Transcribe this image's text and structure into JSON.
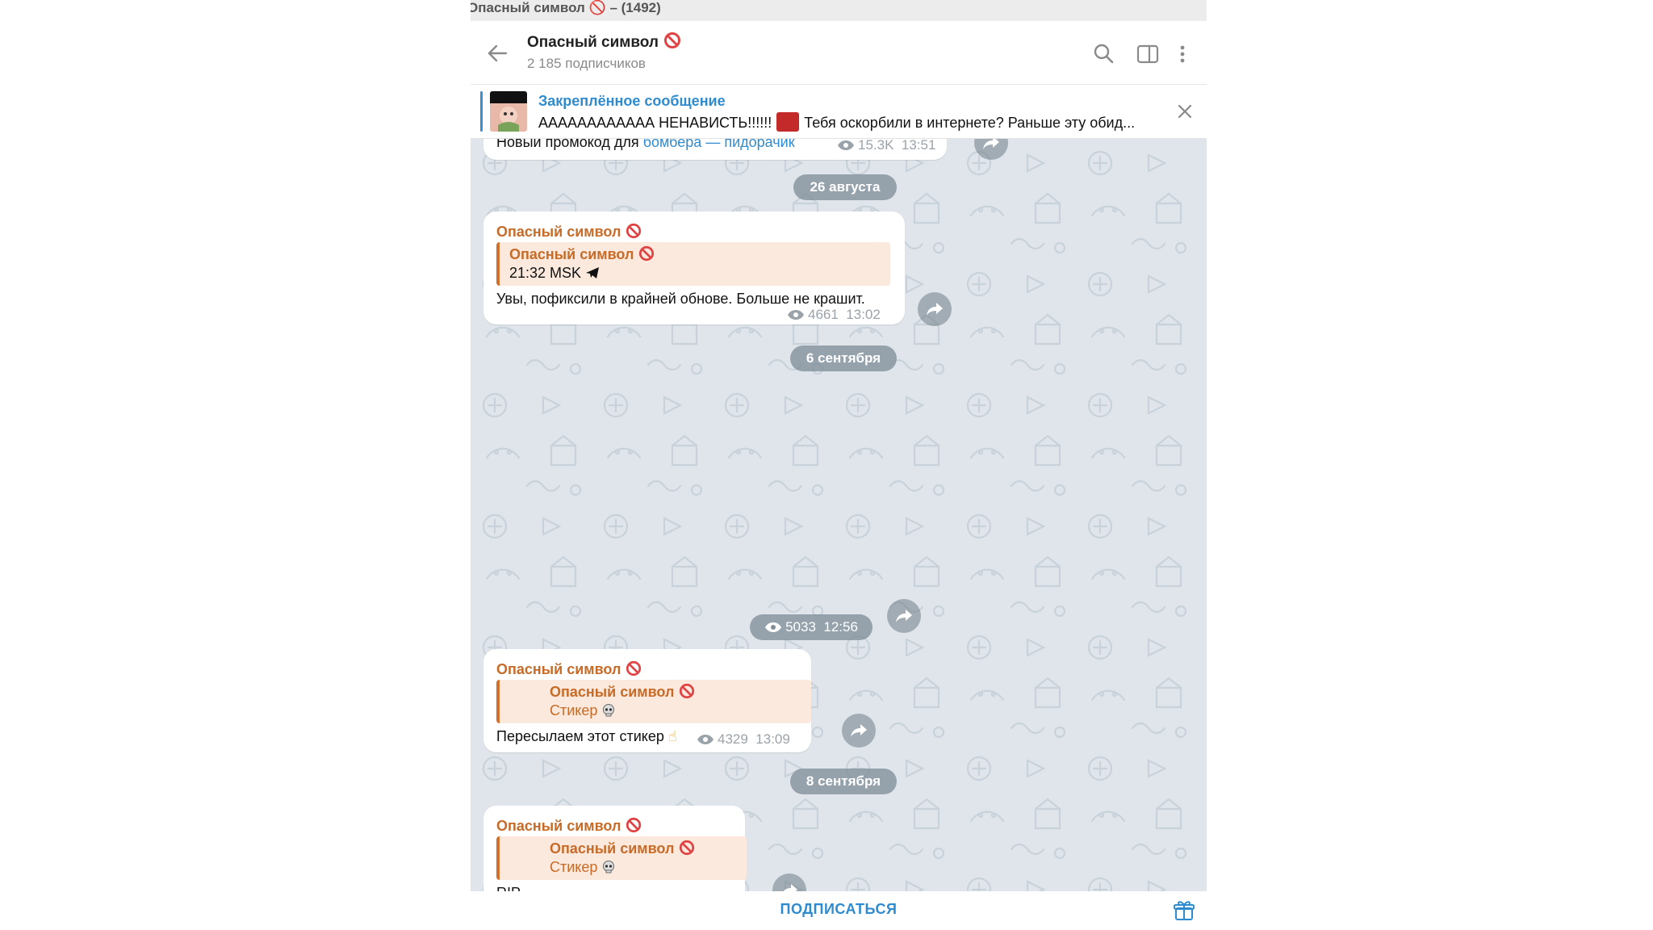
{
  "window": {
    "title": "Опасный символ 🚫 – (1492)"
  },
  "header": {
    "channel_name": "Опасный символ",
    "subscribers": "2 185 подписчиков",
    "icons": [
      "back-arrow-icon",
      "search-icon",
      "sidebar-toggle-icon",
      "more-vertical-icon"
    ]
  },
  "pinned": {
    "title": "Закреплённое сообщение",
    "text_before": "АААААААААААА НЕНАВИСТЬ!!!!!!",
    "text_after": "Тебя оскорбили в интернете? Раньше эту обид..."
  },
  "messages": [
    {
      "partial_text_prefix": "Новый промокод для",
      "partial_link": "бомбера",
      "partial_text_suffix": "— пидорачик",
      "views": "15.3K",
      "time": "13:51"
    },
    {
      "sender": "Опасный символ",
      "reply_name": "Опасный символ",
      "reply_text": "21:32 MSK",
      "text": "Увы, пофиксили в крайней обнове. Больше не крашит.",
      "views": "4661",
      "time": "13:02"
    },
    {
      "views": "5033",
      "time": "12:56"
    },
    {
      "sender": "Опасный символ",
      "reply_name": "Опасный символ",
      "reply_text": "Стикер",
      "text": "Пересылаем этот стикер",
      "emoji": "☝",
      "views": "4329",
      "time": "13:09"
    },
    {
      "sender": "Опасный символ",
      "reply_name": "Опасный символ",
      "reply_text": "Стикер",
      "text": "RIP"
    }
  ],
  "dates": [
    "26 августа",
    "6 сентября",
    "8 сентября"
  ],
  "bottom": {
    "subscribe_label": "ПОДПИСАТЬСЯ",
    "gift_icon": "gift-icon"
  },
  "colors": {
    "accent": "#2f8bcf",
    "sender": "#c76b28",
    "reply_bg": "#fbe9dd",
    "chat_bg": "#dfe5ea"
  }
}
